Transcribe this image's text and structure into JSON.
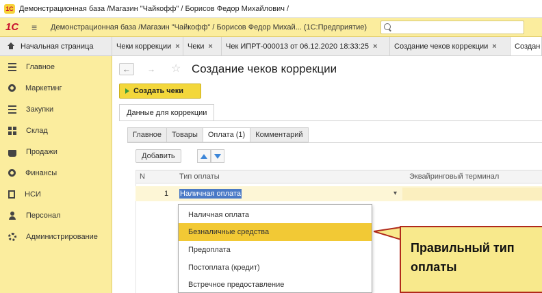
{
  "window": {
    "title": "Демонстрационная база /Магазин \"Чайкофф\" / Борисов Федор Михайлович /",
    "logo": "1C"
  },
  "appbar": {
    "logo": "1С",
    "title": "Демонстрационная база /Магазин \"Чайкофф\" / Борисов Федор Михай...   (1С:Предприятие)"
  },
  "tabs": [
    {
      "label": "Начальная страница"
    },
    {
      "label": "Чеки коррекции"
    },
    {
      "label": "Чеки"
    },
    {
      "label": "Чек ИПРТ-000013 от 06.12.2020 18:33:25"
    },
    {
      "label": "Создание чеков коррекции"
    },
    {
      "label": "Создан"
    }
  ],
  "tab_close_glyph": "×",
  "sidebar": {
    "items": [
      {
        "label": "Главное",
        "icon": "menu-lines-icon"
      },
      {
        "label": "Маркетинг",
        "icon": "target-icon"
      },
      {
        "label": "Закупки",
        "icon": "warehouse-icon"
      },
      {
        "label": "Склад",
        "icon": "grid-icon"
      },
      {
        "label": "Продажи",
        "icon": "bag-icon"
      },
      {
        "label": "Финансы",
        "icon": "coin-icon"
      },
      {
        "label": "НСИ",
        "icon": "document-icon"
      },
      {
        "label": "Персонал",
        "icon": "person-icon"
      },
      {
        "label": "Администрирование",
        "icon": "gear-icon"
      }
    ]
  },
  "form": {
    "back_glyph": "←",
    "forward_glyph": "→",
    "star_glyph": "☆",
    "title": "Создание чеков коррекции",
    "create_button": "Создать чеки",
    "outer_tab": "Данные для коррекции",
    "inner_tabs": [
      {
        "label": "Главное",
        "active": false
      },
      {
        "label": "Товары",
        "active": false
      },
      {
        "label": "Оплата (1)",
        "active": true
      },
      {
        "label": "Комментарий",
        "active": false
      }
    ],
    "add_button": "Добавить"
  },
  "grid": {
    "columns": [
      "N",
      "Тип оплаты",
      "Эквайринговый терминал"
    ],
    "rows": [
      {
        "n": "1",
        "type": "Наличная оплата",
        "caret": "▾"
      }
    ]
  },
  "dropdown": {
    "options": [
      {
        "label": "Наличная оплата",
        "selected": false
      },
      {
        "label": "Безналичные средства",
        "selected": true
      },
      {
        "label": "Предоплата",
        "selected": false
      },
      {
        "label": "Постоплата (кредит)",
        "selected": false
      },
      {
        "label": "Встречное предоставление",
        "selected": false
      }
    ]
  },
  "callout": {
    "line1": "Правильный тип",
    "line2": "оплаты"
  },
  "colors": {
    "accent_yellow": "#fbed9e",
    "button_yellow": "#f3d73b",
    "selection_blue": "#4a79c6",
    "callout_border": "#b02a1b"
  }
}
